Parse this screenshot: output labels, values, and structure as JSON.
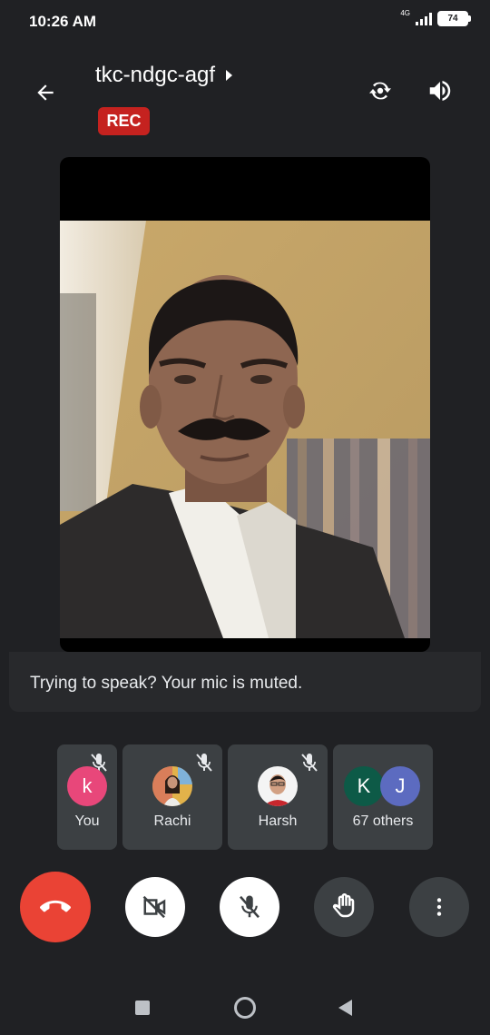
{
  "status_bar": {
    "time": "10:26 AM",
    "network": "4G",
    "battery": "74"
  },
  "header": {
    "meeting_code": "tkc-ndgc-agf",
    "rec_label": "REC",
    "icons": [
      "back-arrow-icon",
      "caret-right-icon",
      "switch-camera-icon",
      "speaker-icon"
    ]
  },
  "video": {
    "description_icon": "participant-video"
  },
  "notice": {
    "text": "Trying to speak? Your mic is muted."
  },
  "participants": [
    {
      "name": "You",
      "initial": "k",
      "avatar_color": "#e8477a",
      "muted": true
    },
    {
      "name": "Rachi",
      "initial": "",
      "muted": true
    },
    {
      "name": "Harsh",
      "initial": "",
      "muted": true
    },
    {
      "name": "67 others",
      "initials": [
        "K",
        "J"
      ],
      "avatar_colors": [
        "#0d5a47",
        "#5c6bc0"
      ],
      "muted": false
    }
  ],
  "controls": {
    "icons": [
      "end-call-icon",
      "camera-off-icon",
      "mic-off-icon",
      "raise-hand-icon",
      "more-options-icon"
    ],
    "end_call_color": "#ea4335"
  },
  "nav": {
    "icons": [
      "recents-icon",
      "home-icon",
      "back-icon"
    ]
  }
}
